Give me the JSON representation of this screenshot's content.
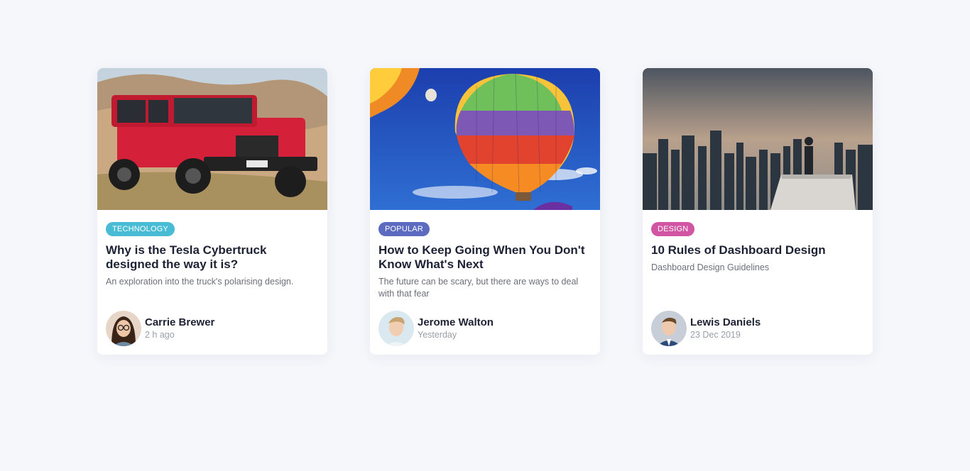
{
  "cards": [
    {
      "tag": "TECHNOLOGY",
      "tag_color": "#47bcd4",
      "title": "Why is the Tesla Cybertruck designed the way it is?",
      "subtitle": "An exploration into the truck's polarising design.",
      "author": "Carrie Brewer",
      "time": "2 h ago"
    },
    {
      "tag": "POPULAR",
      "tag_color": "#5c6bc0",
      "title": "How to Keep Going When You Don't Know What's Next",
      "subtitle": "The future can be scary, but there are ways to deal with that fear",
      "author": "Jerome Walton",
      "time": "Yesterday"
    },
    {
      "tag": "DESIGN",
      "tag_color": "#d155a3",
      "title": "10 Rules of Dashboard Design",
      "subtitle": "Dashboard Design Guidelines",
      "author": "Lewis Daniels",
      "time": "23 Dec 2019"
    }
  ]
}
